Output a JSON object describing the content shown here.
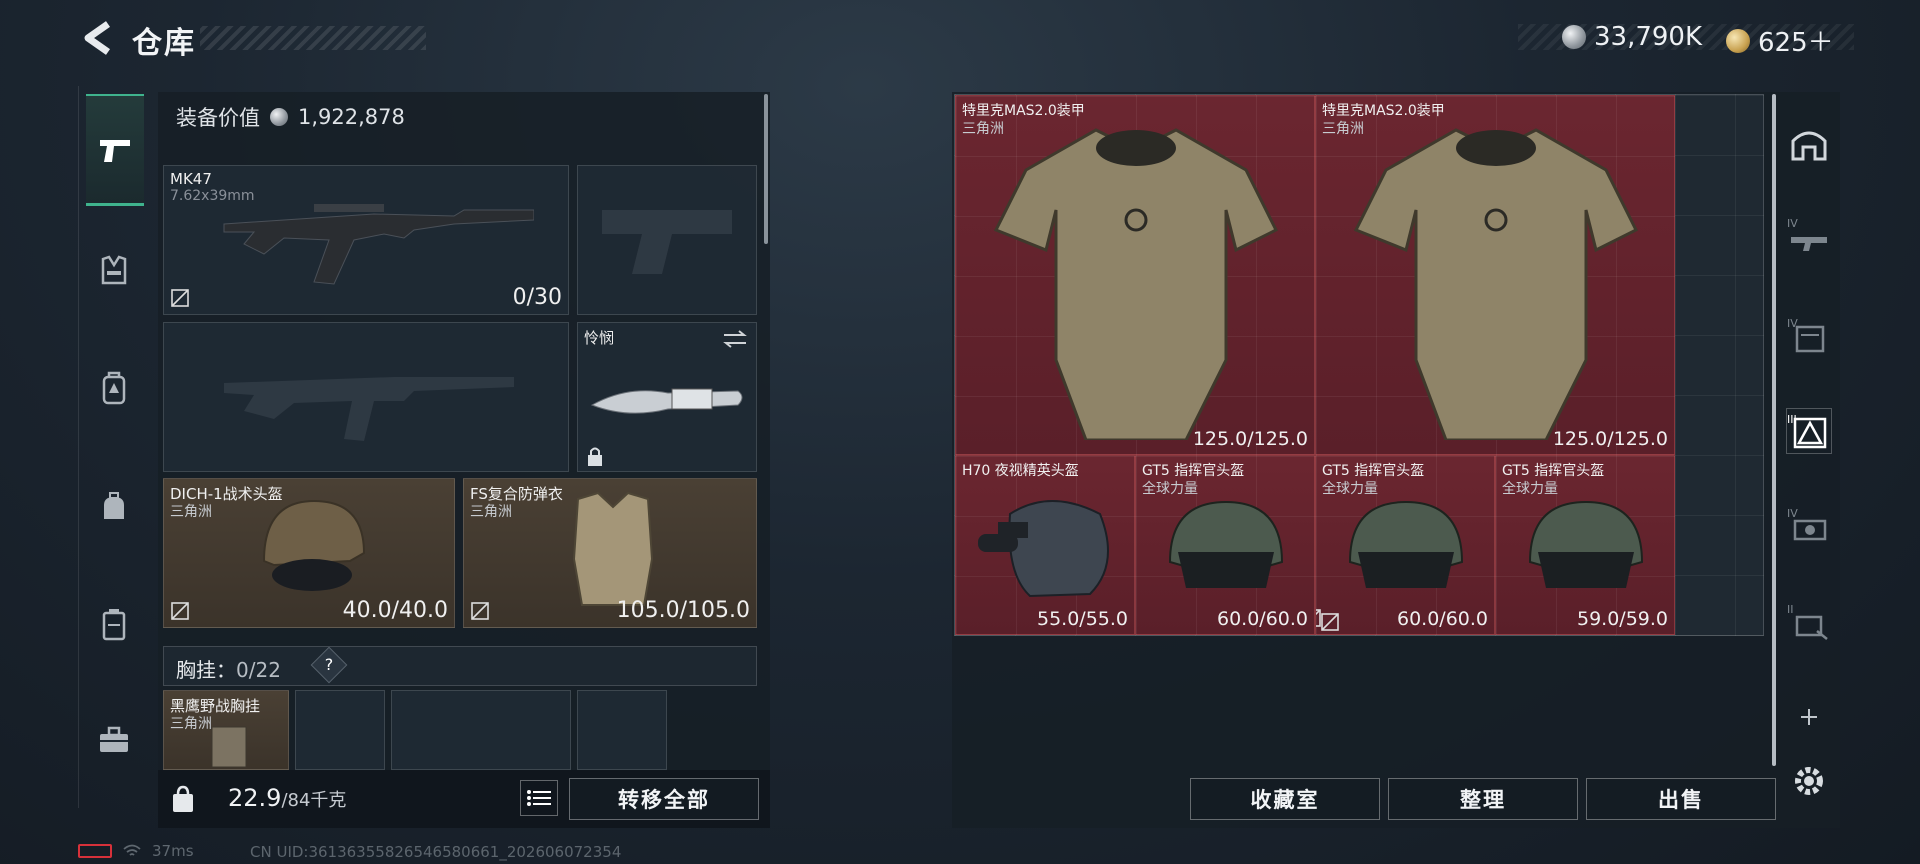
{
  "header": {
    "title": "仓库",
    "currency_silver": "33,790K",
    "currency_gold": "625＋"
  },
  "tabs": [
    "weapon-icon",
    "vest-icon",
    "backpack-armor-icon",
    "backpack-icon",
    "case-icon",
    "toolbox-icon"
  ],
  "loadout": {
    "value_label": "装备价值",
    "value": "1,922,878",
    "primary_weapon": {
      "name": "MK47",
      "caliber": "7.62x39mm",
      "ammo": "0/30"
    },
    "melee": {
      "name": "怜悯"
    },
    "helmet": {
      "name": "DICH-1战术头盔",
      "source": "三角洲",
      "durability": "40.0/40.0"
    },
    "armor": {
      "name": "FS复合防弹衣",
      "source": "三角洲",
      "durability": "105.0/105.0"
    },
    "rig_label": "胸挂：",
    "rig_capacity": "0/22",
    "rig_help": "?",
    "rig_item": {
      "name": "黑鹰野战胸挂",
      "source": "三角洲"
    }
  },
  "footer_left": {
    "weight": "22.9",
    "weight_max": "/84千克",
    "transfer_all": "转移全部"
  },
  "storage_items": [
    {
      "name": "特里克MAS2.0装甲",
      "source": "三角洲",
      "durability": "125.0/125.0"
    },
    {
      "name": "特里克MAS2.0装甲",
      "source": "三角洲",
      "durability": "125.0/125.0"
    },
    {
      "name": "H70 夜视精英头盔",
      "source": "",
      "durability": "55.0/55.0"
    },
    {
      "name": "GT5 指挥官头盔",
      "source": "全球力量",
      "durability": "60.0/60.0"
    },
    {
      "name": "GT5 指挥官头盔",
      "source": "全球力量",
      "durability": "60.0/60.0"
    },
    {
      "name": "GT5 指挥官头盔",
      "source": "全球力量",
      "durability": "59.0/59.0"
    }
  ],
  "footer_right": {
    "collection": "收藏室",
    "sort": "整理",
    "sell": "出售"
  },
  "side_icons": [
    "home-shelter-icon",
    "tier-iv-rifle-icon",
    "tier-iv-vest-icon",
    "tier-iii-armor-filter-icon",
    "tier-iv-gear-icon",
    "tier-ii-weapon-icon",
    "add-icon",
    "settings-icon"
  ],
  "side_labels": [
    "IV",
    "IV",
    "III",
    "IV",
    "II"
  ],
  "status": {
    "ping": "37ms",
    "uid": "CN UID:36136355826546580661_202606072354"
  }
}
